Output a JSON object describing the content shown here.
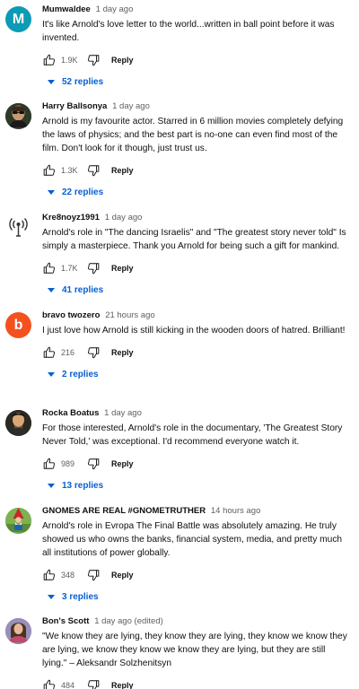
{
  "comments": [
    {
      "author": "Mumwaldee",
      "time": "1 day ago",
      "text": "It's like Arnold's love letter to the world...written in ball point before it was invented.",
      "likes": "1.9K",
      "reply_label": "Reply",
      "replies": "52 replies",
      "avatar_letter": "M",
      "avatar_color": "#0b9bb5"
    },
    {
      "author": "Harry Ballsonya",
      "time": "1 day ago",
      "text": "Arnold is my favourite actor. Starred in 6 million movies completely defying the laws of physics; and the best part is no-one can even find most of the film. Don't look for it though, just trust us.",
      "likes": "1.3K",
      "reply_label": "Reply",
      "replies": "22 replies",
      "avatar_icon": "person-sunglasses-icon"
    },
    {
      "author": "Kre8noyz1991",
      "time": "1 day ago",
      "text": "Arnold's role in \"The dancing Israelis\" and \"The greatest story never told\" Is simply a masterpiece. Thank you Arnold for being such a gift for mankind.",
      "likes": "1.7K",
      "reply_label": "Reply",
      "replies": "41 replies",
      "avatar_icon": "broadcast-tower-icon"
    },
    {
      "author": "bravo twozero",
      "time": "21 hours ago",
      "text": "I just love how Arnold is still kicking in the wooden doors of hatred. Brilliant!",
      "likes": "216",
      "reply_label": "Reply",
      "replies": "2 replies",
      "avatar_letter": "b",
      "avatar_color": "#f4511e"
    },
    {
      "author": "Rocka Boatus",
      "time": "1 day ago",
      "text": "For those interested, Arnold's role in the documentary, 'The Greatest Story Never Told,' was exceptional. I'd recommend everyone watch it.",
      "likes": "989",
      "reply_label": "Reply",
      "replies": "13 replies",
      "avatar_icon": "portrait-painting-icon"
    },
    {
      "author": "GNOMES ARE REAL #GNOMETRUTHER",
      "time": "14 hours ago",
      "text": "Arnold's role in Evropa The Final Battle was absolutely amazing. He truly showed us who owns the banks, financial system, media, and pretty much all institutions of power globally.",
      "likes": "348",
      "reply_label": "Reply",
      "replies": "3 replies",
      "avatar_icon": "gnome-icon"
    },
    {
      "author": "Bon's Scott",
      "time": "1 day ago (edited)",
      "text": "\"We know they are lying, they know they are lying, they know we know they are lying, we know they know we know they are lying, but they are still lying.\" – Aleksandr Solzhenitsyn",
      "likes": "484",
      "reply_label": "Reply",
      "avatar_icon": "person-photo-icon"
    }
  ]
}
